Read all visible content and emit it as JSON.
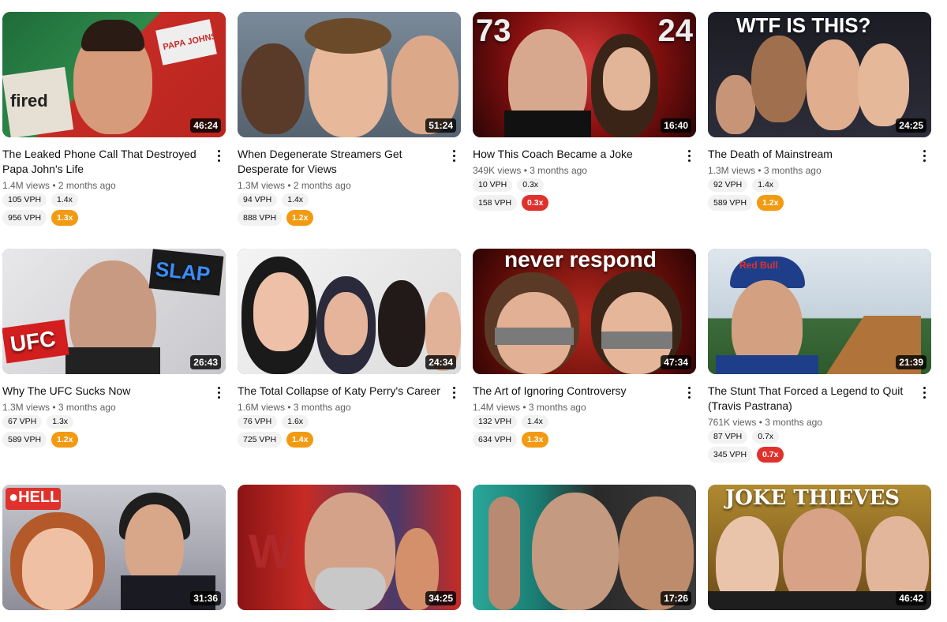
{
  "colors": {
    "orange": "#f29a12",
    "red": "#e0322d"
  },
  "videos": [
    {
      "title": "The Leaked Phone Call That Destroyed Papa John's Life",
      "views": "1.4M views",
      "age": "2 months ago",
      "duration": "46:24",
      "vph_recent": "105 VPH",
      "mult_recent": "1.4x",
      "vph": "956 VPH",
      "mult": "1.3x",
      "mult_color": "#f29a12",
      "overlay": "fired",
      "overlay2": "PAPA JOHNS"
    },
    {
      "title": "When Degenerate Streamers Get Desperate for Views",
      "views": "1.3M views",
      "age": "2 months ago",
      "duration": "51:24",
      "vph_recent": "94 VPH",
      "mult_recent": "1.4x",
      "vph": "888 VPH",
      "mult": "1.2x",
      "mult_color": "#f29a12",
      "overlay": "",
      "overlay2": ""
    },
    {
      "title": "How This Coach Became a Joke",
      "views": "349K views",
      "age": "3 months ago",
      "duration": "16:40",
      "vph_recent": "10 VPH",
      "mult_recent": "0.3x",
      "vph": "158 VPH",
      "mult": "0.3x",
      "mult_color": "#e0322d",
      "overlay": "73",
      "overlay2": "24"
    },
    {
      "title": "The Death of Mainstream",
      "views": "1.3M views",
      "age": "3 months ago",
      "duration": "24:25",
      "vph_recent": "92 VPH",
      "mult_recent": "1.4x",
      "vph": "589 VPH",
      "mult": "1.2x",
      "mult_color": "#f29a12",
      "overlay": "WTF IS THIS?",
      "overlay2": ""
    },
    {
      "title": "Why The UFC Sucks Now",
      "views": "1.3M views",
      "age": "3 months ago",
      "duration": "26:43",
      "vph_recent": "67 VPH",
      "mult_recent": "1.3x",
      "vph": "589 VPH",
      "mult": "1.2x",
      "mult_color": "#f29a12",
      "overlay": "UFC",
      "overlay2": "SLAP"
    },
    {
      "title": "The Total Collapse of Katy Perry's Career",
      "views": "1.6M views",
      "age": "3 months ago",
      "duration": "24:34",
      "vph_recent": "76 VPH",
      "mult_recent": "1.6x",
      "vph": "725 VPH",
      "mult": "1.4x",
      "mult_color": "#f29a12",
      "overlay": "",
      "overlay2": ""
    },
    {
      "title": "The Art of Ignoring Controversy",
      "views": "1.4M views",
      "age": "3 months ago",
      "duration": "47:34",
      "vph_recent": "132 VPH",
      "mult_recent": "1.4x",
      "vph": "634 VPH",
      "mult": "1.3x",
      "mult_color": "#f29a12",
      "overlay": "never respond",
      "overlay2": ""
    },
    {
      "title": "The Stunt That Forced a Legend to Quit (Travis Pastrana)",
      "views": "761K views",
      "age": "3 months ago",
      "duration": "21:39",
      "vph_recent": "87 VPH",
      "mult_recent": "0.7x",
      "vph": "345 VPH",
      "mult": "0.7x",
      "mult_color": "#e0322d",
      "overlay": "Red Bull",
      "overlay2": ""
    },
    {
      "title": "",
      "views": "",
      "age": "",
      "duration": "31:36",
      "overlay": "●HELL",
      "overlay2": ""
    },
    {
      "title": "",
      "views": "",
      "age": "",
      "duration": "34:25",
      "overlay": "W",
      "overlay2": ""
    },
    {
      "title": "",
      "views": "",
      "age": "",
      "duration": "17:26",
      "overlay": "",
      "overlay2": ""
    },
    {
      "title": "",
      "views": "",
      "age": "",
      "duration": "46:42",
      "overlay": "JOKE THIEVES",
      "overlay2": ""
    }
  ]
}
